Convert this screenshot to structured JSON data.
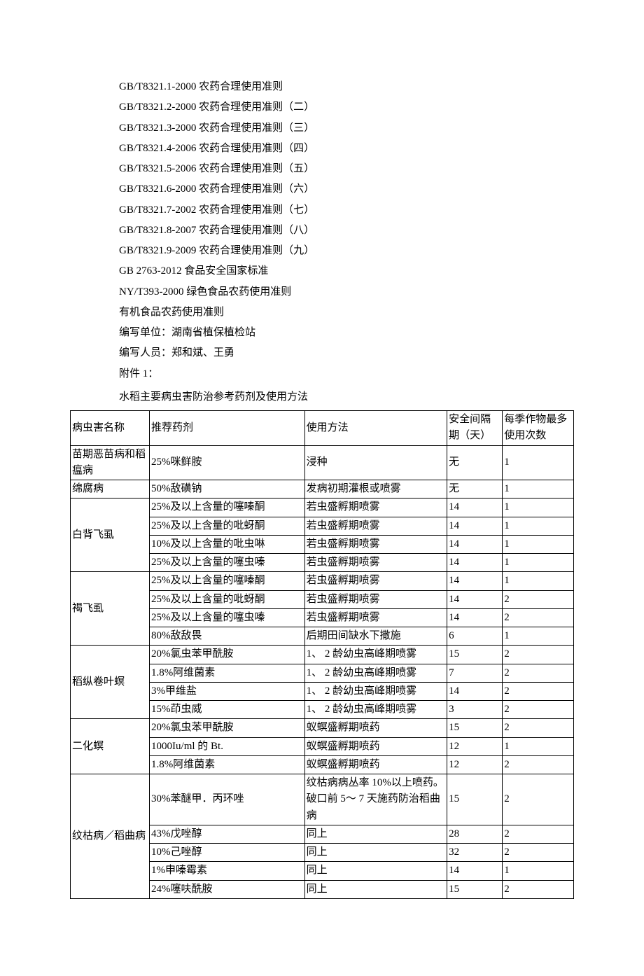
{
  "references": [
    "GB/T8321.1-2000   农药合理使用准则",
    "GB/T8321.2-2000   农药合理使用准则（二）",
    "GB/T8321.3-2000   农药合理使用准则（三）",
    "GB/T8321.4-2006   农药合理使用准则（四）",
    "GB/T8321.5-2006   农药合理使用准则（五）",
    "GB/T8321.6-2000   农药合理使用准则（六）",
    "GB/T8321.7-2002   农药合理使用准则（七）",
    "GB/T8321.8-2007   农药合理使用准则（八）",
    "GB/T8321.9-2009   农药合理使用准则（九）",
    "GB 2763-2012   食品安全国家标准",
    "NY/T393-2000   绿色食品农药使用准则",
    "有机食品农药使用准则",
    "编写单位：湖南省植保植检站",
    "编写人员：郑和斌、王勇",
    "附件 1："
  ],
  "table_title": "水稻主要病虫害防治参考药剂及使用方法",
  "headers": {
    "name": "病虫害名称",
    "drug": "推荐药剂",
    "method": "使用方法",
    "interval": "安全间隔期（天）",
    "count": "每季作物最多使用次数"
  },
  "rows": [
    {
      "name": "苗期恶苗病和稻瘟病",
      "rowspan": 1,
      "drug": "25%咪鲜胺",
      "method": "浸种",
      "interval": "无",
      "count": "1"
    },
    {
      "name": "绵腐病",
      "rowspan": 1,
      "drug": "50%敌磺钠",
      "method": "发病初期灌根或喷雾",
      "interval": "无",
      "count": "1"
    },
    {
      "name": "白背飞虱",
      "rowspan": 4,
      "drug": "25%及以上含量的噻嗪酮",
      "method": "若虫盛孵期喷雾",
      "interval": "14",
      "count": "1"
    },
    {
      "drug": "25%及以上含量的吡蚜酮",
      "method": "若虫盛孵期喷雾",
      "interval": "14",
      "count": "1"
    },
    {
      "drug": "10%及以上含量的吡虫啉",
      "method": "若虫盛孵期喷雾",
      "interval": "14",
      "count": "1"
    },
    {
      "drug": "25%及以上含量的噻虫嗪",
      "method": "若虫盛孵期喷雾",
      "interval": "14",
      "count": "1"
    },
    {
      "name": "褐飞虱",
      "rowspan": 4,
      "drug": "25%及以上含量的噻嗪酮",
      "method": "若虫盛孵期喷雾",
      "interval": "14",
      "count": "1"
    },
    {
      "drug": "25%及以上含量的吡蚜酮",
      "method": "若虫盛孵期喷雾",
      "interval": "14",
      "count": "2"
    },
    {
      "drug": "25%及以上含量的噻虫嗪",
      "method": "若虫盛孵期喷雾",
      "interval": "14",
      "count": "2"
    },
    {
      "drug": "80%敌敌畏",
      "method": "后期田间缺水下撒施",
      "interval": "6",
      "count": "1"
    },
    {
      "name": "稻纵卷叶螟",
      "rowspan": 4,
      "drug": "20%氯虫苯甲酰胺",
      "method": "1、 2 龄幼虫高峰期喷雾",
      "interval": "15",
      "count": "2"
    },
    {
      "drug": "1.8%阿维菌素",
      "method": "1、 2 龄幼虫高峰期喷雾",
      "interval": "7",
      "count": "2"
    },
    {
      "drug": "3%甲维盐",
      "method": "1、 2 龄幼虫高峰期喷雾",
      "interval": "14",
      "count": "2"
    },
    {
      "drug": "15%茚虫威",
      "method": "1、 2 龄幼虫高峰期喷雾",
      "interval": "3",
      "count": "2"
    },
    {
      "name": "二化螟",
      "rowspan": 3,
      "drug": "20%氯虫苯甲酰胺",
      "method": "蚁螟盛孵期喷药",
      "interval": "15",
      "count": "2"
    },
    {
      "drug": "1000Iu/ml  的 Bt.",
      "method": "蚁螟盛孵期喷药",
      "interval": "12",
      "count": "1"
    },
    {
      "drug": "1.8%阿维菌素",
      "method": "蚁螟盛孵期喷药",
      "interval": "12",
      "count": "2"
    },
    {
      "name": "纹枯病／稻曲病",
      "rowspan": 5,
      "drug": "30%苯醚甲．丙环唑",
      "method": "纹枯病病丛率 10%以上喷药。破口前 5～ 7 天施药防治稻曲病",
      "interval": "15",
      "count": "2"
    },
    {
      "drug": "43%戊唑醇",
      "method": "同上",
      "interval": "28",
      "count": "2"
    },
    {
      "drug": "10%己唑醇",
      "method": "同上",
      "interval": "32",
      "count": "2"
    },
    {
      "drug": "1%申嗪霉素",
      "method": "同上",
      "interval": "14",
      "count": "1"
    },
    {
      "drug": "24%噻呋酰胺",
      "method": "同上",
      "interval": "15",
      "count": "2"
    }
  ]
}
